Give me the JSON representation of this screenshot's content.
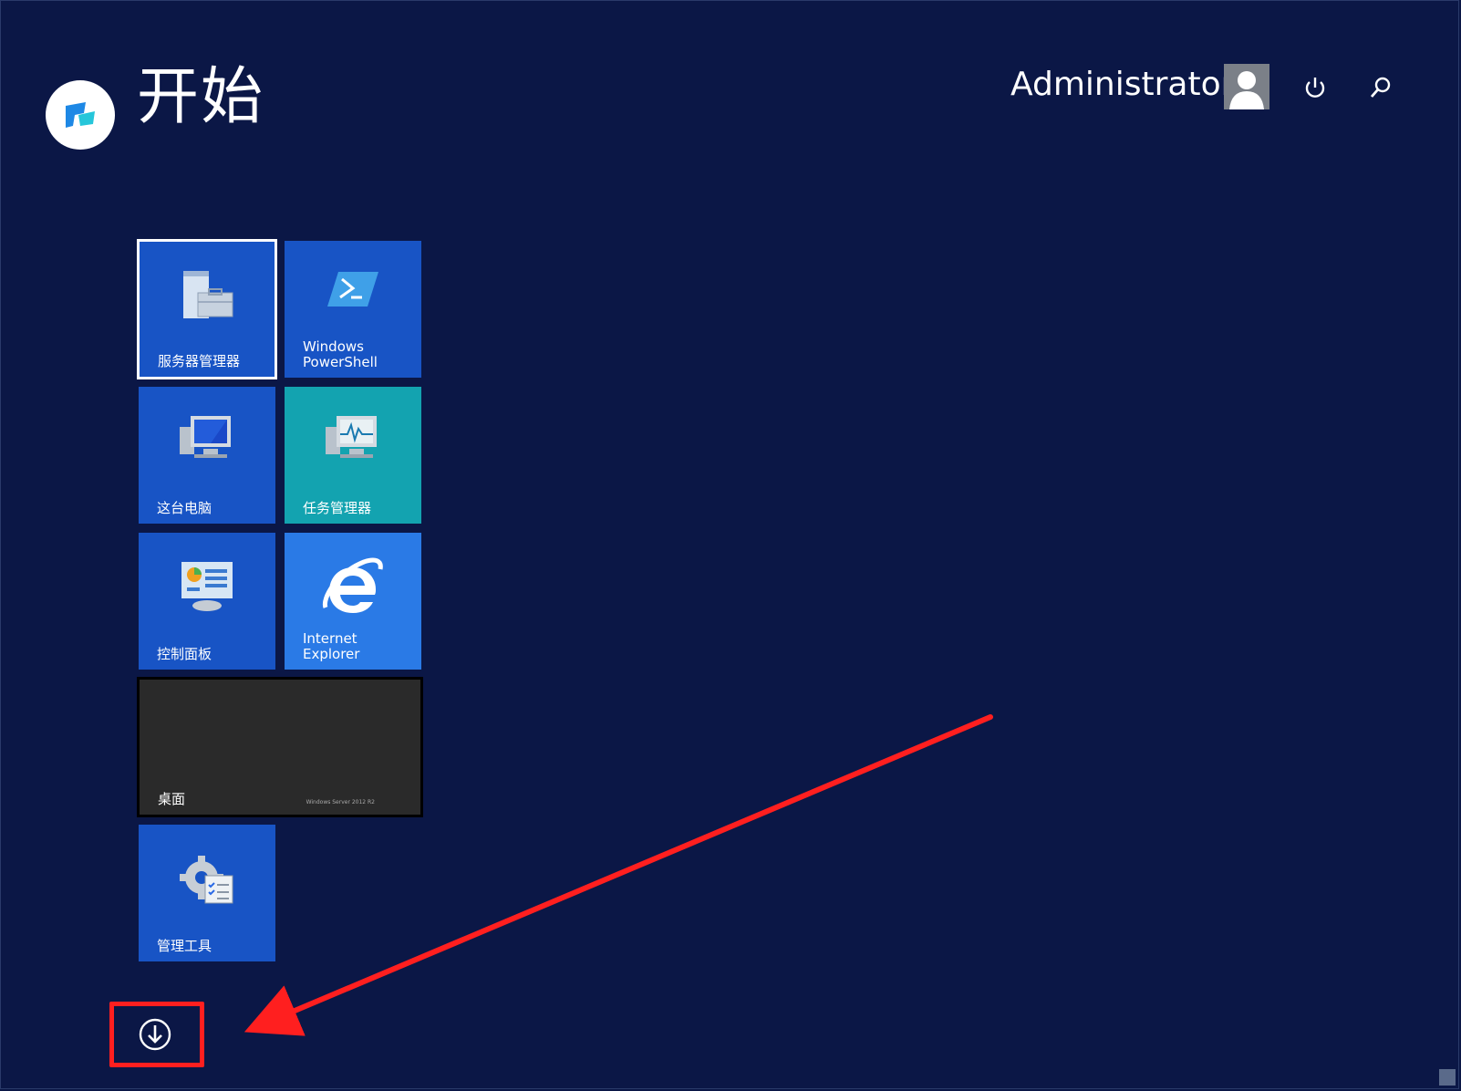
{
  "header": {
    "title": "开始",
    "user_name": "Administrator",
    "icons": {
      "logo": "brand-logo-icon",
      "avatar": "user-avatar-icon",
      "power": "power-icon",
      "search": "search-icon"
    }
  },
  "tiles": [
    {
      "label": "服务器管理器",
      "icon": "server-manager-icon",
      "color": "#1854c5",
      "selected": true
    },
    {
      "label": "Windows\nPowerShell",
      "icon": "powershell-icon",
      "color": "#1854c5"
    },
    {
      "label": "这台电脑",
      "icon": "computer-icon",
      "color": "#1854c5"
    },
    {
      "label": "任务管理器",
      "icon": "task-manager-icon",
      "color": "#13a3b0"
    },
    {
      "label": "控制面板",
      "icon": "control-panel-icon",
      "color": "#1854c5"
    },
    {
      "label": "Internet\nExplorer",
      "icon": "internet-explorer-icon",
      "color": "#2a7ae6"
    },
    {
      "label": "桌面",
      "icon": "desktop-icon",
      "color": "#2a2a2a",
      "watermark": "Windows Server 2012 R2"
    },
    {
      "label": "管理工具",
      "icon": "admin-tools-icon",
      "color": "#1854c5"
    }
  ],
  "footer": {
    "apps_button_icon": "down-arrow-circle-icon",
    "highlight_color": "#ff1f1f"
  },
  "colors": {
    "background": "#0b1746",
    "accent_blue": "#1854c5"
  }
}
